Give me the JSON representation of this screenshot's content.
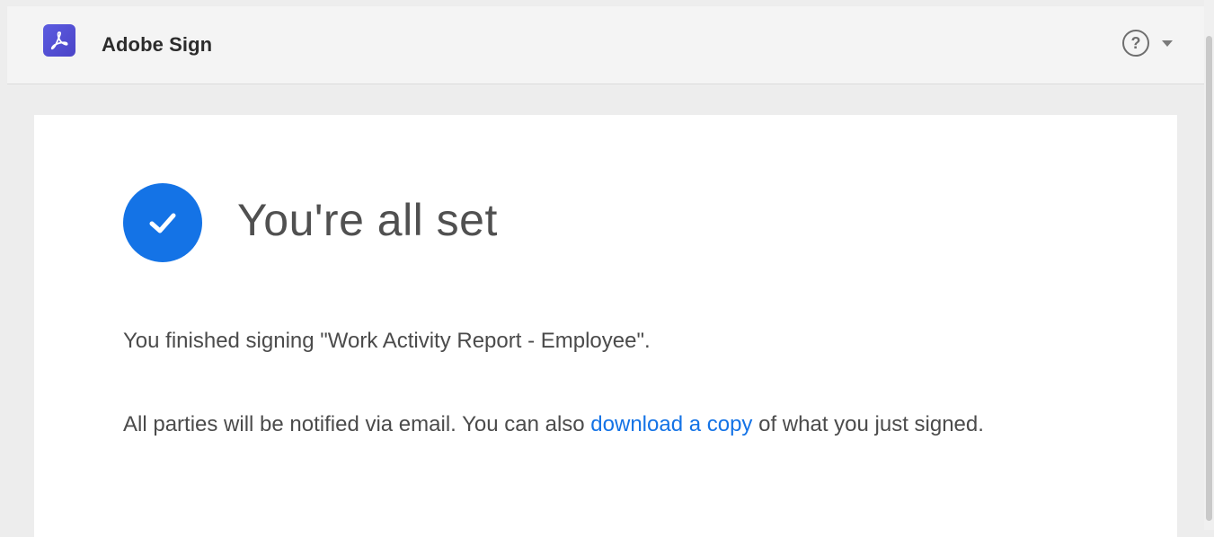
{
  "header": {
    "app_title": "Adobe Sign",
    "logo_icon": "adobe-acrobat-icon",
    "help_icon": "help-icon",
    "help_menu_icon": "chevron-down-icon"
  },
  "confirmation": {
    "status_icon": "checkmark-icon",
    "headline": "You're all set",
    "finished_message": "You finished signing \"Work Activity Report - Employee\".",
    "notify_prefix": "All parties will be notified via email. You can also ",
    "download_link_label": "download a copy",
    "notify_suffix": " of what you just signed."
  },
  "colors": {
    "accent": "#1473e6",
    "logo": "#4b44c8"
  }
}
